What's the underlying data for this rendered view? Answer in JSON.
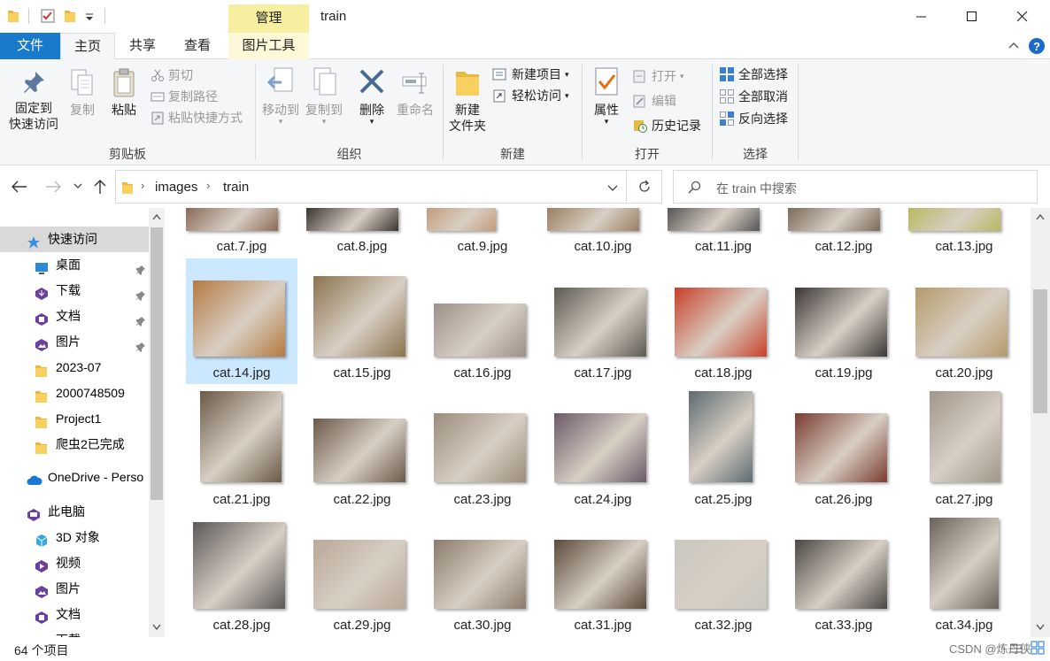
{
  "window": {
    "title": "train",
    "context_tab_group": "管理",
    "controls": {
      "minimize": "minimize-icon",
      "maximize": "maximize-icon",
      "close": "close-icon"
    }
  },
  "tabs": [
    {
      "label": "文件",
      "active": false,
      "style": "file"
    },
    {
      "label": "主页",
      "active": true
    },
    {
      "label": "共享",
      "active": false
    },
    {
      "label": "查看",
      "active": false
    },
    {
      "label": "图片工具",
      "active": false
    }
  ],
  "ribbon": {
    "clipboard": {
      "label": "剪贴板",
      "pin": "固定到",
      "pin2": "快速访问",
      "copy": "复制",
      "paste": "粘贴",
      "cut": "剪切",
      "copy_path": "复制路径",
      "paste_shortcut": "粘贴快捷方式"
    },
    "organize": {
      "label": "组织",
      "move_to": "移动到",
      "copy_to": "复制到",
      "delete": "删除",
      "rename": "重命名"
    },
    "new": {
      "label": "新建",
      "new_folder": "新建",
      "new_folder2": "文件夹",
      "new_item": "新建项目",
      "easy_access": "轻松访问"
    },
    "open": {
      "label": "打开",
      "properties": "属性",
      "open": "打开",
      "edit": "编辑",
      "history": "历史记录"
    },
    "select": {
      "label": "选择",
      "select_all": "全部选择",
      "select_none": "全部取消",
      "invert": "反向选择"
    }
  },
  "address": {
    "crumbs": [
      "images",
      "train"
    ],
    "search_placeholder": "在 train 中搜索"
  },
  "nav": {
    "items": [
      {
        "label": "快速访问",
        "icon": "star-icon",
        "level": 0,
        "selected": true
      },
      {
        "label": "桌面",
        "icon": "desktop-icon",
        "level": 1,
        "pinned": true
      },
      {
        "label": "下载",
        "icon": "download-icon",
        "level": 1,
        "pinned": true
      },
      {
        "label": "文档",
        "icon": "document-icon",
        "level": 1,
        "pinned": true
      },
      {
        "label": "图片",
        "icon": "picture-icon",
        "level": 1,
        "pinned": true
      },
      {
        "label": "2023-07",
        "icon": "folder-icon",
        "level": 1
      },
      {
        "label": "2000748509",
        "icon": "folder-icon",
        "level": 1
      },
      {
        "label": "Project1",
        "icon": "folder-icon",
        "level": 1
      },
      {
        "label": "爬虫2已完成",
        "icon": "folder-icon",
        "level": 1
      },
      {
        "label": "OneDrive - Perso",
        "icon": "cloud-icon",
        "level": 0
      },
      {
        "label": "此电脑",
        "icon": "computer-icon",
        "level": 0
      },
      {
        "label": "3D 对象",
        "icon": "cube-icon",
        "level": 1
      },
      {
        "label": "视频",
        "icon": "video-icon",
        "level": 1
      },
      {
        "label": "图片",
        "icon": "picture-icon",
        "level": 1
      },
      {
        "label": "文档",
        "icon": "document-icon",
        "level": 1
      },
      {
        "label": "下载",
        "icon": "download-icon",
        "level": 1
      }
    ]
  },
  "files": [
    {
      "name": "cat.7.jpg",
      "color": "#8a6a58"
    },
    {
      "name": "cat.8.jpg",
      "color": "#3a3530"
    },
    {
      "name": "cat.9.jpg",
      "color": "#c49a7a"
    },
    {
      "name": "cat.10.jpg",
      "color": "#9a7f62"
    },
    {
      "name": "cat.11.jpg",
      "color": "#555"
    },
    {
      "name": "cat.12.jpg",
      "color": "#7a6a5a"
    },
    {
      "name": "cat.13.jpg",
      "color": "#b8b860"
    },
    {
      "name": "cat.14.jpg",
      "color": "#b57a42",
      "selected": true
    },
    {
      "name": "cat.15.jpg",
      "color": "#8b7350"
    },
    {
      "name": "cat.16.jpg",
      "color": "#9c9088"
    },
    {
      "name": "cat.17.jpg",
      "color": "#5d5a52"
    },
    {
      "name": "cat.18.jpg",
      "color": "#c8402a"
    },
    {
      "name": "cat.19.jpg",
      "color": "#3c3838"
    },
    {
      "name": "cat.20.jpg",
      "color": "#b59a6a"
    },
    {
      "name": "cat.21.jpg",
      "color": "#6a5a48"
    },
    {
      "name": "cat.22.jpg",
      "color": "#6b5a4a"
    },
    {
      "name": "cat.23.jpg",
      "color": "#9a8c7a"
    },
    {
      "name": "cat.24.jpg",
      "color": "#6a5a68"
    },
    {
      "name": "cat.25.jpg",
      "color": "#5c6a70"
    },
    {
      "name": "cat.26.jpg",
      "color": "#7a3c30"
    },
    {
      "name": "cat.27.jpg",
      "color": "#a0968a"
    },
    {
      "name": "cat.28.jpg",
      "color": "#5a5858"
    },
    {
      "name": "cat.29.jpg",
      "color": "#b8a898"
    },
    {
      "name": "cat.30.jpg",
      "color": "#8a7c6c"
    },
    {
      "name": "cat.31.jpg",
      "color": "#5a4a3a"
    },
    {
      "name": "cat.32.jpg",
      "color": "#c8c8c0"
    },
    {
      "name": "cat.33.jpg",
      "color": "#4a4844"
    },
    {
      "name": "cat.34.jpg",
      "color": "#6a625a"
    }
  ],
  "status": {
    "count": "64 个项目",
    "watermark": "CSDN @炼丹侠"
  },
  "colors": {
    "accent": "#1979ca",
    "context_tab": "#f7efa0",
    "selection": "#cce8ff"
  }
}
